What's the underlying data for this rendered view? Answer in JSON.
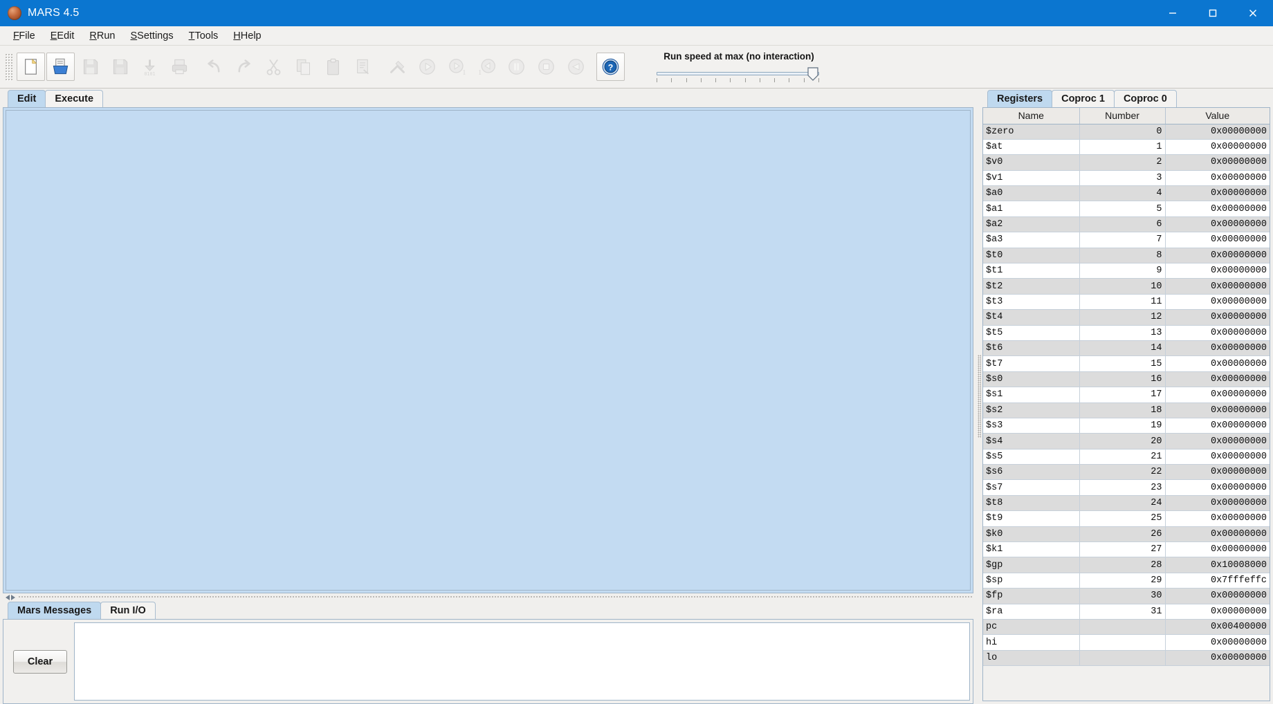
{
  "window": {
    "title": "MARS 4.5",
    "icon": "planet-icon",
    "controls": {
      "minimize": "–",
      "maximize": "□",
      "close": "✕"
    }
  },
  "menubar": {
    "items": [
      {
        "label": "File",
        "mnemonic": "F"
      },
      {
        "label": "Edit",
        "mnemonic": "E"
      },
      {
        "label": "Run",
        "mnemonic": "R"
      },
      {
        "label": "Settings",
        "mnemonic": "S"
      },
      {
        "label": "Tools",
        "mnemonic": "T"
      },
      {
        "label": "Help",
        "mnemonic": "H"
      }
    ]
  },
  "toolbar": {
    "buttons": [
      {
        "name": "new-file-button",
        "icon": "new-document-icon",
        "enabled": true
      },
      {
        "name": "open-file-button",
        "icon": "open-folder-icon",
        "enabled": true
      },
      {
        "name": "save-file-button",
        "icon": "save-disk-icon",
        "enabled": false
      },
      {
        "name": "save-as-button",
        "icon": "save-as-icon",
        "enabled": false
      },
      {
        "name": "dump-memory-button",
        "icon": "dump-memory-icon",
        "enabled": false
      },
      {
        "name": "print-button",
        "icon": "printer-icon",
        "enabled": false
      },
      {
        "name": "undo-button",
        "icon": "undo-arrow-icon",
        "enabled": false
      },
      {
        "name": "redo-button",
        "icon": "redo-arrow-icon",
        "enabled": false
      },
      {
        "name": "cut-button",
        "icon": "scissors-icon",
        "enabled": false
      },
      {
        "name": "copy-button",
        "icon": "copy-pages-icon",
        "enabled": false
      },
      {
        "name": "paste-button",
        "icon": "clipboard-icon",
        "enabled": false
      },
      {
        "name": "find-replace-button",
        "icon": "find-replace-icon",
        "enabled": false
      },
      {
        "name": "assemble-button",
        "icon": "wrench-screwdriver-icon",
        "enabled": false
      },
      {
        "name": "run-button",
        "icon": "play-icon",
        "enabled": false
      },
      {
        "name": "step-button",
        "icon": "step-forward-icon",
        "enabled": false
      },
      {
        "name": "backstep-button",
        "icon": "step-backward-icon",
        "enabled": false
      },
      {
        "name": "pause-button",
        "icon": "pause-icon",
        "enabled": false
      },
      {
        "name": "stop-button",
        "icon": "stop-icon",
        "enabled": false
      },
      {
        "name": "reset-button",
        "icon": "reset-icon",
        "enabled": false
      },
      {
        "name": "help-button",
        "icon": "help-question-icon",
        "enabled": true
      }
    ],
    "run_speed": {
      "label": "Run speed at max (no interaction)",
      "value": 100,
      "min": 0,
      "max": 100
    }
  },
  "editor": {
    "tabs": [
      {
        "label": "Edit",
        "active": true
      },
      {
        "label": "Execute",
        "active": false
      }
    ],
    "content": ""
  },
  "messages": {
    "tabs": [
      {
        "label": "Mars Messages",
        "active": true
      },
      {
        "label": "Run I/O",
        "active": false
      }
    ],
    "clear_label": "Clear",
    "content": ""
  },
  "registers": {
    "tabs": [
      {
        "label": "Registers",
        "active": true
      },
      {
        "label": "Coproc 1",
        "active": false
      },
      {
        "label": "Coproc 0",
        "active": false
      }
    ],
    "columns": [
      "Name",
      "Number",
      "Value"
    ],
    "rows": [
      {
        "name": "$zero",
        "number": "0",
        "value": "0x00000000"
      },
      {
        "name": "$at",
        "number": "1",
        "value": "0x00000000"
      },
      {
        "name": "$v0",
        "number": "2",
        "value": "0x00000000"
      },
      {
        "name": "$v1",
        "number": "3",
        "value": "0x00000000"
      },
      {
        "name": "$a0",
        "number": "4",
        "value": "0x00000000"
      },
      {
        "name": "$a1",
        "number": "5",
        "value": "0x00000000"
      },
      {
        "name": "$a2",
        "number": "6",
        "value": "0x00000000"
      },
      {
        "name": "$a3",
        "number": "7",
        "value": "0x00000000"
      },
      {
        "name": "$t0",
        "number": "8",
        "value": "0x00000000"
      },
      {
        "name": "$t1",
        "number": "9",
        "value": "0x00000000"
      },
      {
        "name": "$t2",
        "number": "10",
        "value": "0x00000000"
      },
      {
        "name": "$t3",
        "number": "11",
        "value": "0x00000000"
      },
      {
        "name": "$t4",
        "number": "12",
        "value": "0x00000000"
      },
      {
        "name": "$t5",
        "number": "13",
        "value": "0x00000000"
      },
      {
        "name": "$t6",
        "number": "14",
        "value": "0x00000000"
      },
      {
        "name": "$t7",
        "number": "15",
        "value": "0x00000000"
      },
      {
        "name": "$s0",
        "number": "16",
        "value": "0x00000000"
      },
      {
        "name": "$s1",
        "number": "17",
        "value": "0x00000000"
      },
      {
        "name": "$s2",
        "number": "18",
        "value": "0x00000000"
      },
      {
        "name": "$s3",
        "number": "19",
        "value": "0x00000000"
      },
      {
        "name": "$s4",
        "number": "20",
        "value": "0x00000000"
      },
      {
        "name": "$s5",
        "number": "21",
        "value": "0x00000000"
      },
      {
        "name": "$s6",
        "number": "22",
        "value": "0x00000000"
      },
      {
        "name": "$s7",
        "number": "23",
        "value": "0x00000000"
      },
      {
        "name": "$t8",
        "number": "24",
        "value": "0x00000000"
      },
      {
        "name": "$t9",
        "number": "25",
        "value": "0x00000000"
      },
      {
        "name": "$k0",
        "number": "26",
        "value": "0x00000000"
      },
      {
        "name": "$k1",
        "number": "27",
        "value": "0x00000000"
      },
      {
        "name": "$gp",
        "number": "28",
        "value": "0x10008000"
      },
      {
        "name": "$sp",
        "number": "29",
        "value": "0x7fffeffc"
      },
      {
        "name": "$fp",
        "number": "30",
        "value": "0x00000000"
      },
      {
        "name": "$ra",
        "number": "31",
        "value": "0x00000000"
      },
      {
        "name": "pc",
        "number": "",
        "value": "0x00400000"
      },
      {
        "name": "hi",
        "number": "",
        "value": "0x00000000"
      },
      {
        "name": "lo",
        "number": "",
        "value": "0x00000000"
      }
    ]
  },
  "colors": {
    "titlebar": "#0b76d0",
    "tab_active": "#bfd9ef",
    "editor_background": "#c3dbf2",
    "panel_background": "#f0efed",
    "row_odd": "#dcdcdc",
    "row_even": "#ffffff"
  }
}
